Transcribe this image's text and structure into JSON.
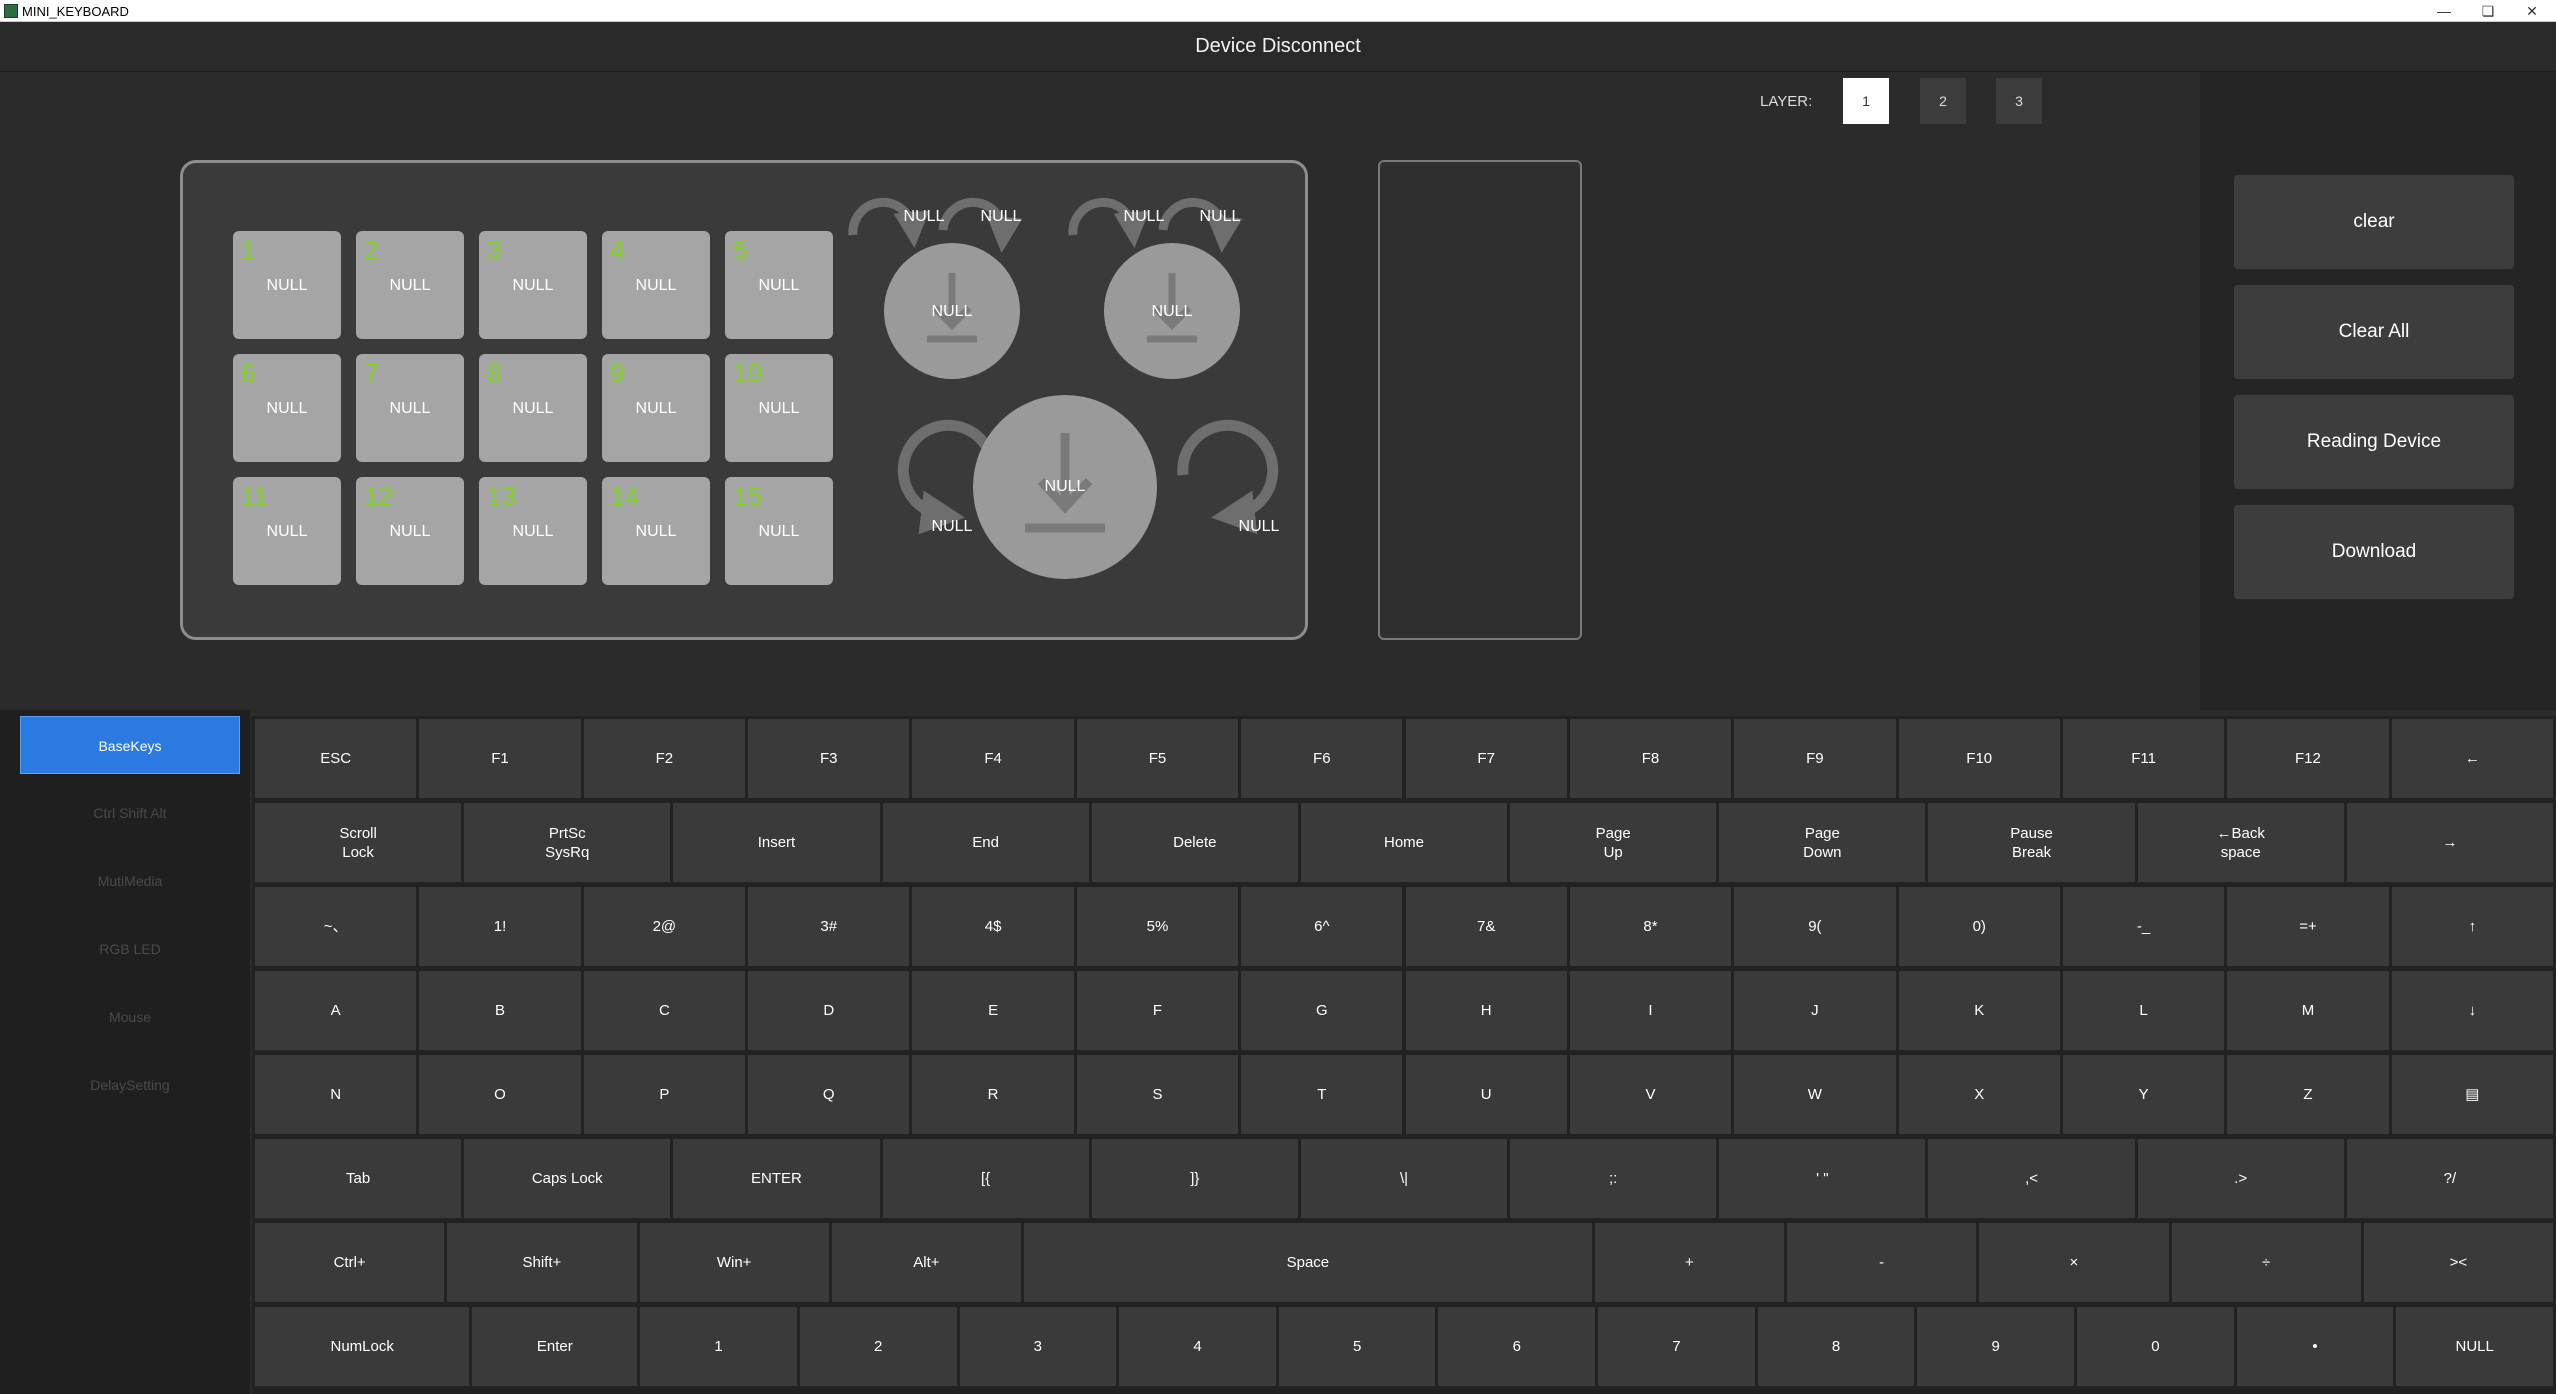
{
  "window": {
    "title": "MINI_KEYBOARD",
    "minimize": "—",
    "restore": "❏",
    "close": "✕"
  },
  "header": {
    "status": "Device Disconnect"
  },
  "layers": {
    "label": "LAYER:",
    "items": [
      "1",
      "2",
      "3"
    ],
    "active": "1"
  },
  "pad_keys": [
    {
      "num": "1",
      "val": "NULL"
    },
    {
      "num": "2",
      "val": "NULL"
    },
    {
      "num": "3",
      "val": "NULL"
    },
    {
      "num": "4",
      "val": "NULL"
    },
    {
      "num": "5",
      "val": "NULL"
    },
    {
      "num": "6",
      "val": "NULL"
    },
    {
      "num": "7",
      "val": "NULL"
    },
    {
      "num": "8",
      "val": "NULL"
    },
    {
      "num": "9",
      "val": "NULL"
    },
    {
      "num": "10",
      "val": "NULL"
    },
    {
      "num": "11",
      "val": "NULL"
    },
    {
      "num": "12",
      "val": "NULL"
    },
    {
      "num": "13",
      "val": "NULL"
    },
    {
      "num": "14",
      "val": "NULL"
    },
    {
      "num": "15",
      "val": "NULL"
    }
  ],
  "knobs": {
    "knob1": {
      "ccw": "NULL",
      "cw": "NULL",
      "press": "NULL"
    },
    "knob2": {
      "ccw": "NULL",
      "cw": "NULL",
      "press": "NULL"
    },
    "knob3": {
      "ccw": "NULL",
      "cw": "NULL",
      "press": "NULL"
    }
  },
  "actions": {
    "clear": "clear",
    "clear_all": "Clear All",
    "reading_device": "Reading Device",
    "download": "Download"
  },
  "sidebar": {
    "items": [
      "BaseKeys",
      "Ctrl Shift Alt",
      "MutiMedia",
      "RGB LED",
      "Mouse",
      "DelaySetting"
    ],
    "active": "BaseKeys"
  },
  "keyboard": {
    "rows": [
      [
        "ESC",
        "F1",
        "F2",
        "F3",
        "F4",
        "F5",
        "F6",
        "F7",
        "F8",
        "F9",
        "F10",
        "F11",
        "F12",
        "←"
      ],
      [
        "Scroll\nLock",
        "PrtSc\nSysRq",
        "Insert",
        "End",
        "Delete",
        "Home",
        "Page\nUp",
        "Page\nDown",
        "Pause\nBreak",
        "←Back\nspace",
        "→"
      ],
      [
        "~、",
        "1!",
        "2@",
        "3#",
        "4$",
        "5%",
        "6^",
        "7&",
        "8*",
        "9(",
        "0)",
        "-_",
        "=+",
        "↑"
      ],
      [
        "A",
        "B",
        "C",
        "D",
        "E",
        "F",
        "G",
        "H",
        "I",
        "J",
        "K",
        "L",
        "M",
        "↓"
      ],
      [
        "N",
        "O",
        "P",
        "Q",
        "R",
        "S",
        "T",
        "U",
        "V",
        "W",
        "X",
        "Y",
        "Z",
        "▤"
      ],
      [
        "Tab",
        "Caps Lock",
        "ENTER",
        "[{",
        "]}",
        "\\|",
        ";:",
        "' \"",
        ",<",
        ".>",
        "?/"
      ],
      [
        "Ctrl+",
        "Shift+",
        "Win+",
        "Alt+",
        "Space",
        "+",
        "-",
        "×",
        "÷",
        "><"
      ],
      [
        "NumLock",
        "Enter",
        "1",
        "2",
        "3",
        "4",
        "5",
        "6",
        "7",
        "8",
        "9",
        "0",
        "•",
        "NULL"
      ]
    ]
  }
}
